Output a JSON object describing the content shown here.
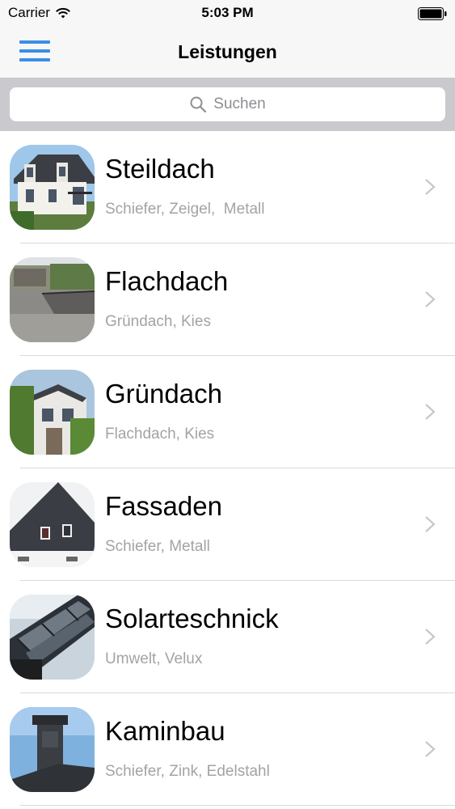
{
  "status_bar": {
    "carrier": "Carrier",
    "time": "5:03 PM",
    "wifi_icon": "wifi-icon",
    "battery_icon": "battery-icon"
  },
  "nav": {
    "title": "Leistungen",
    "menu_icon": "hamburger-menu-icon",
    "accent_color": "#3a8ee6"
  },
  "search": {
    "placeholder": "Suchen",
    "icon": "search-icon"
  },
  "services": [
    {
      "name": "Steildach",
      "subtitle": "Schiefer, Zeigel,  Metall",
      "image": "steep-roof-house-photo"
    },
    {
      "name": "Flachdach",
      "subtitle": "Gründach, Kies",
      "image": "flat-roof-photo"
    },
    {
      "name": "Gründach",
      "subtitle": "Flachdach, Kies",
      "image": "green-roof-photo"
    },
    {
      "name": "Fassaden",
      "subtitle": "Schiefer, Metall",
      "image": "slate-facade-photo"
    },
    {
      "name": "Solarteschnick",
      "subtitle": "Umwelt, Velux",
      "image": "solar-panels-photo"
    },
    {
      "name": "Kaminbau",
      "subtitle": "Schiefer, Zink, Edelstahl",
      "image": "chimney-photo"
    }
  ],
  "colors": {
    "subtitle_text": "#a3a3a8",
    "search_background": "#c9c9ce",
    "bar_background": "#f7f7f7"
  }
}
